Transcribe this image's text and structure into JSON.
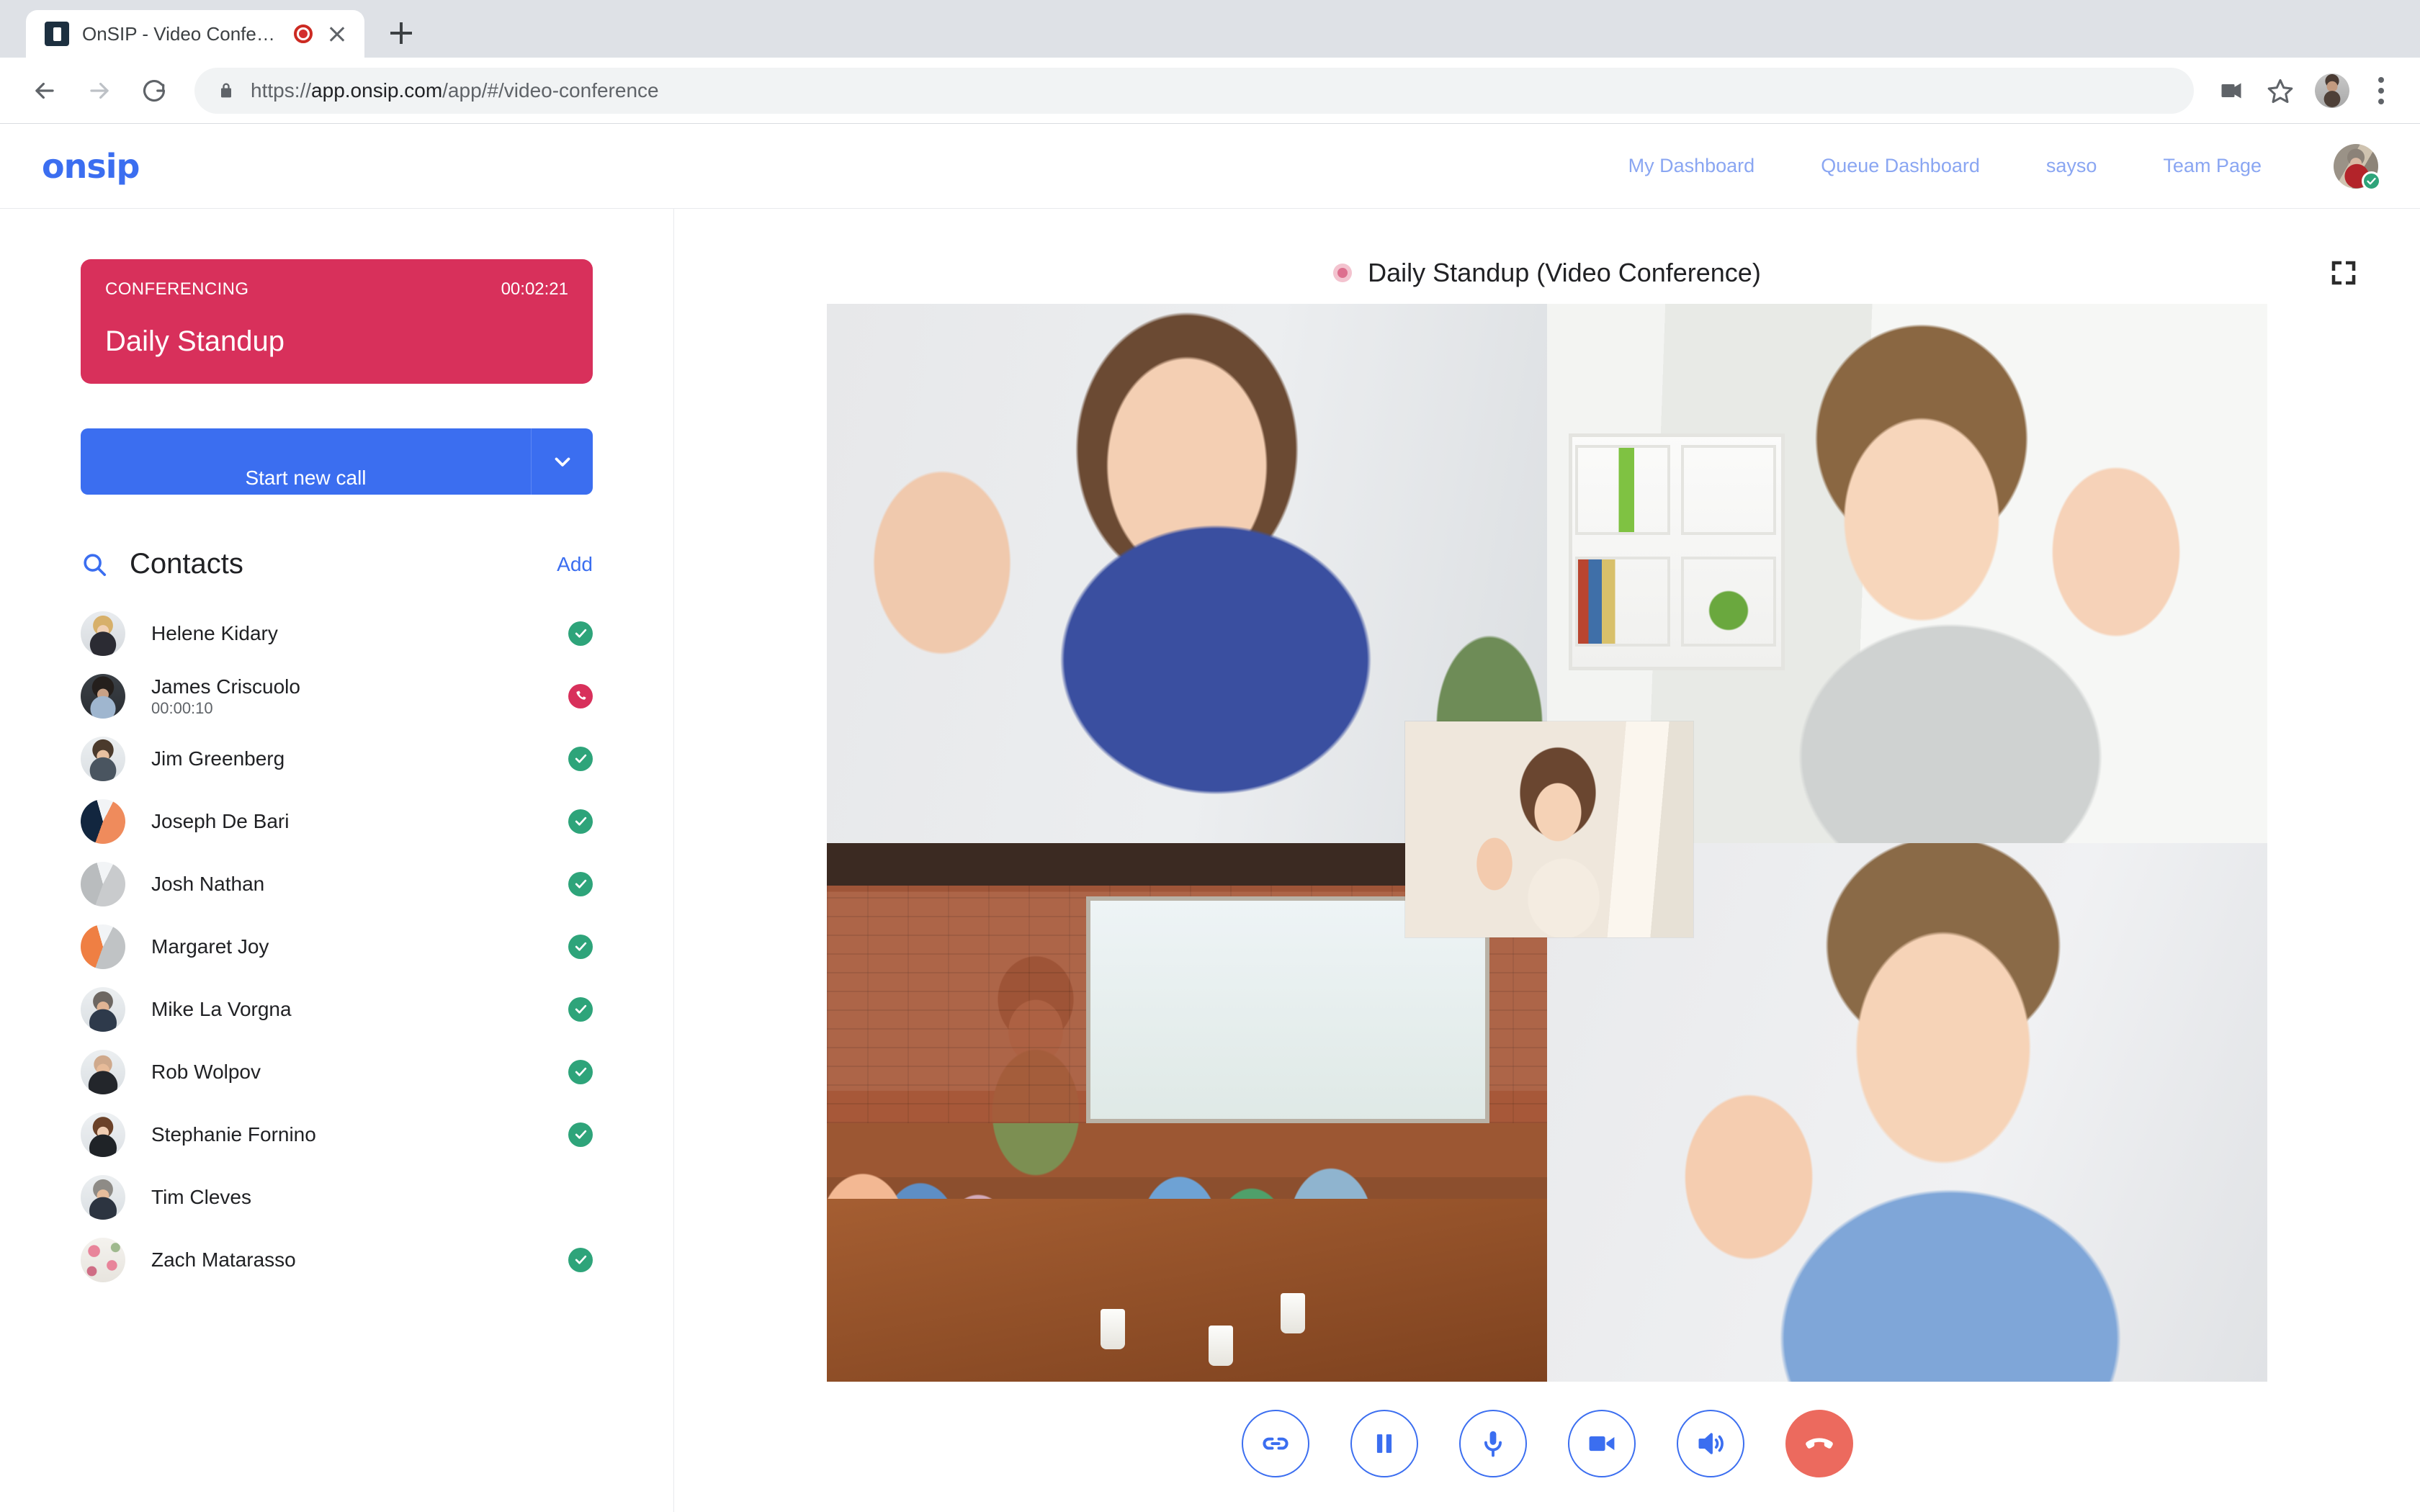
{
  "browser": {
    "tab": {
      "title": "OnSIP - Video Conference",
      "favicon": "onsip-favicon",
      "recording": "recording-indicator"
    },
    "url_scheme": "https://",
    "url_domain": "app.onsip.com",
    "url_path": "/app/#/video-conference",
    "icons": {
      "back": "back-arrow-icon",
      "forward": "forward-arrow-icon",
      "reload": "reload-icon",
      "lock": "lock-icon",
      "camera": "camera-permission-icon",
      "bookmark": "star-icon",
      "menu": "three-dot-menu-icon"
    }
  },
  "header": {
    "logo": "onsip",
    "nav": [
      {
        "label": "My Dashboard"
      },
      {
        "label": "Queue Dashboard"
      },
      {
        "label": "sayso"
      },
      {
        "label": "Team Page"
      }
    ],
    "avatar_status": "available"
  },
  "sidebar": {
    "conference_card": {
      "label": "CONFERENCING",
      "timer": "00:02:21",
      "name": "Daily Standup"
    },
    "start_call": {
      "label": "Start new call"
    },
    "contacts": {
      "title": "Contacts",
      "add_label": "Add",
      "items": [
        {
          "name": "Helene Kidary",
          "sub": "",
          "status": "available"
        },
        {
          "name": "James Criscuolo",
          "sub": "00:00:10",
          "status": "oncall"
        },
        {
          "name": "Jim Greenberg",
          "sub": "",
          "status": "available"
        },
        {
          "name": "Joseph De Bari",
          "sub": "",
          "status": "available"
        },
        {
          "name": "Josh Nathan",
          "sub": "",
          "status": "available"
        },
        {
          "name": "Margaret Joy",
          "sub": "",
          "status": "available"
        },
        {
          "name": "Mike La Vorgna",
          "sub": "",
          "status": "available"
        },
        {
          "name": "Rob Wolpov",
          "sub": "",
          "status": "available"
        },
        {
          "name": "Stephanie Fornino",
          "sub": "",
          "status": "available"
        },
        {
          "name": "Tim Cleves",
          "sub": "",
          "status": "offline"
        },
        {
          "name": "Zach Matarasso",
          "sub": "",
          "status": "available"
        }
      ]
    }
  },
  "main": {
    "conference_title": "Daily Standup (Video Conference)",
    "expand_icon": "fullscreen-icon",
    "participants": [
      {
        "label": "participant-top-left"
      },
      {
        "label": "participant-top-right"
      },
      {
        "label": "participant-bottom-left"
      },
      {
        "label": "participant-bottom-right"
      },
      {
        "label": "self-view-pip"
      }
    ],
    "controls": [
      {
        "name": "merge-call-button",
        "icon": "link-icon"
      },
      {
        "name": "hold-button",
        "icon": "pause-icon"
      },
      {
        "name": "mute-microphone-button",
        "icon": "microphone-icon"
      },
      {
        "name": "toggle-video-button",
        "icon": "video-camera-icon"
      },
      {
        "name": "speaker-button",
        "icon": "speaker-icon"
      },
      {
        "name": "hangup-button",
        "icon": "hangup-phone-icon"
      }
    ]
  },
  "colors": {
    "brand_blue": "#3b6ef0",
    "nav_link": "#8aa6f2",
    "conference_red": "#d8305b",
    "status_green": "#2ea47a",
    "hangup_red": "#ec6a5e"
  }
}
